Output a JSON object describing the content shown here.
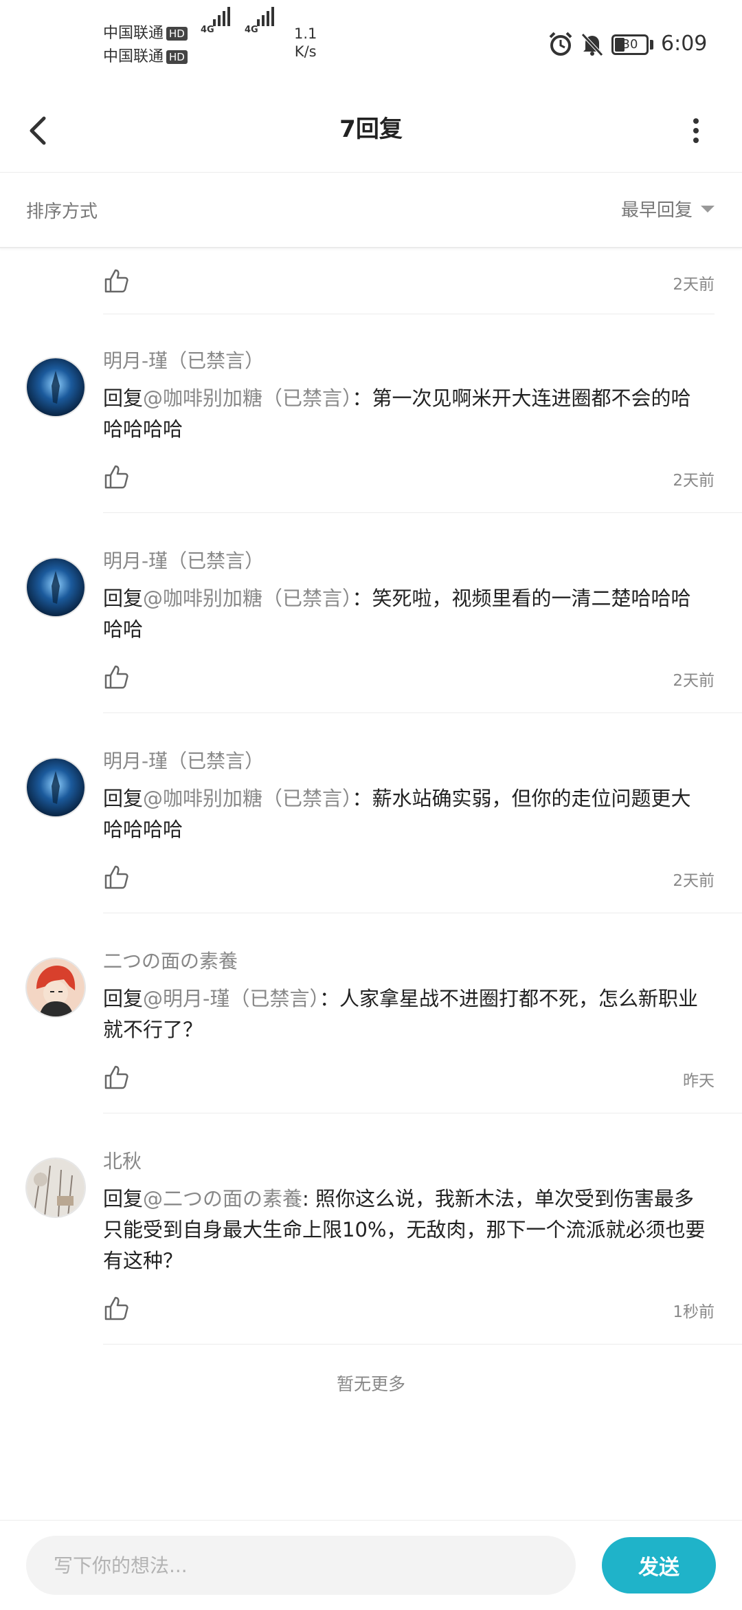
{
  "status_bar": {
    "carrier1": "中国联通",
    "carrier2": "中国联通",
    "hd": "HD",
    "signal_label": "4G",
    "net_speed_value": "1.1",
    "net_speed_unit": "K/s",
    "battery": "30",
    "time": "6:09"
  },
  "header": {
    "title": "7回复"
  },
  "sort": {
    "label": "排序方式",
    "selected": "最早回复"
  },
  "partial": {
    "time": "2天前"
  },
  "comments": [
    {
      "author": "明月-瑾（已禁言）",
      "reply_prefix": "回复",
      "mention": "@咖啡别加糖（已禁言）",
      "text": "：第一次见啊米开大连进圈都不会的哈哈哈哈哈",
      "time": "2天前"
    },
    {
      "author": "明月-瑾（已禁言）",
      "reply_prefix": "回复",
      "mention": "@咖啡别加糖（已禁言）",
      "text": "：笑死啦，视频里看的一清二楚哈哈哈哈哈",
      "time": "2天前"
    },
    {
      "author": "明月-瑾（已禁言）",
      "reply_prefix": "回复",
      "mention": "@咖啡别加糖（已禁言）",
      "text": "：薪水站确实弱，但你的走位问题更大哈哈哈哈",
      "time": "2天前"
    },
    {
      "author": "二つの面の素養",
      "reply_prefix": "回复",
      "mention": "@明月-瑾（已禁言）",
      "text": "：人家拿星战不进圈打都不死，怎么新职业就不行了？",
      "time": "昨天"
    },
    {
      "author": "北秋",
      "reply_prefix": "回复",
      "mention": "@二つの面の素養",
      "text": ": 照你这么说，我新木法，单次受到伤害最多只能受到自身最大生命上限10%，无敌肉，那下一个流派就必须也要有这种？",
      "time": "1秒前"
    }
  ],
  "footer_note": "暂无更多",
  "composer": {
    "placeholder": "写下你的想法...",
    "send_label": "发送"
  },
  "colors": {
    "accent": "#1fb3c9",
    "muted": "#888888"
  }
}
